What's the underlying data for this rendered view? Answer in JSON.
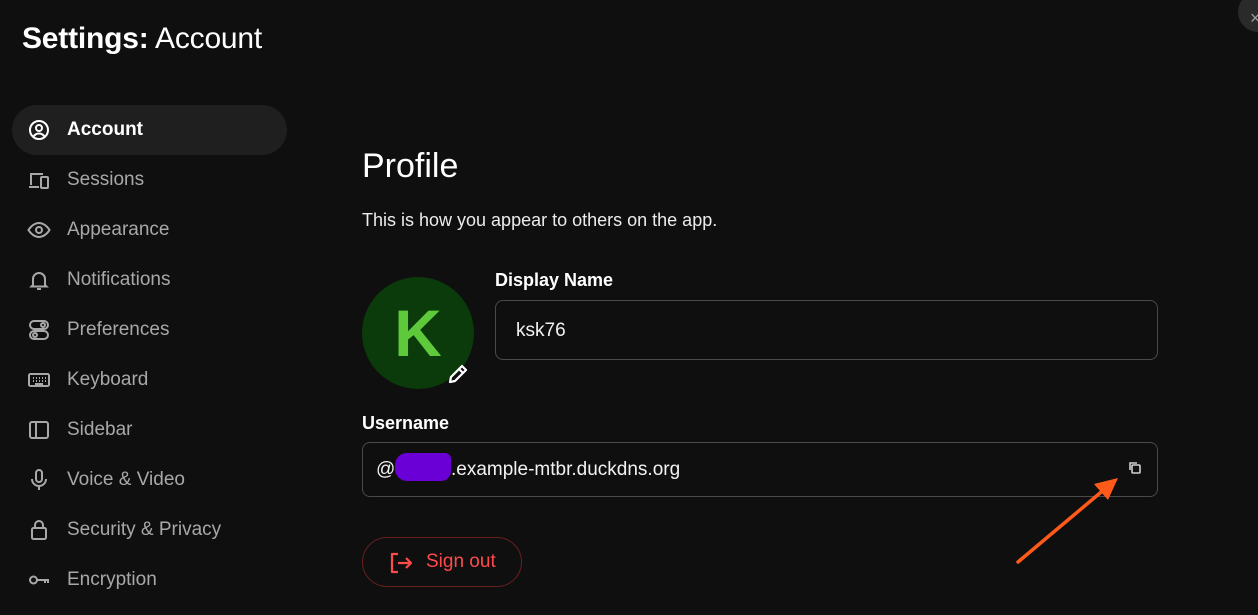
{
  "header": {
    "title_prefix": "Settings:",
    "title_suffix": "Account",
    "close_glyph": "×"
  },
  "sidebar": {
    "items": [
      {
        "label": "Account",
        "icon": "user-circle-icon",
        "active": true
      },
      {
        "label": "Sessions",
        "icon": "devices-icon"
      },
      {
        "label": "Appearance",
        "icon": "eye-icon"
      },
      {
        "label": "Notifications",
        "icon": "bell-icon"
      },
      {
        "label": "Preferences",
        "icon": "toggles-icon"
      },
      {
        "label": "Keyboard",
        "icon": "keyboard-icon"
      },
      {
        "label": "Sidebar",
        "icon": "sidebar-icon"
      },
      {
        "label": "Voice & Video",
        "icon": "microphone-icon"
      },
      {
        "label": "Security & Privacy",
        "icon": "lock-icon"
      },
      {
        "label": "Encryption",
        "icon": "key-icon"
      }
    ]
  },
  "profile": {
    "heading": "Profile",
    "description": "This is how you appear to others on the app.",
    "avatar_letter": "K",
    "display_name_label": "Display Name",
    "display_name_value": "ksk76",
    "username_label": "Username",
    "username_prefix": "@",
    "username_suffix": ".example-mtbr.duckdns.org",
    "sign_out_label": "Sign out"
  },
  "colors": {
    "background": "#0f0f0f",
    "avatar_bg": "#0b3a0b",
    "avatar_letter": "#5ec93a",
    "danger": "#ff4a4a",
    "arrow": "#ff5a1a",
    "redaction": "#6b00d6"
  }
}
